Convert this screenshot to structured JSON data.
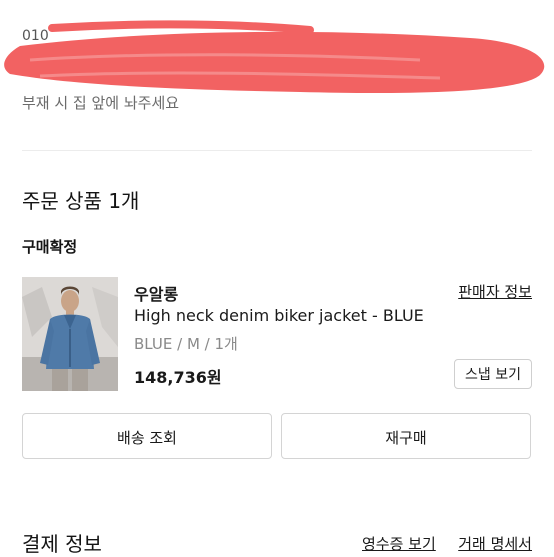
{
  "delivery": {
    "note": "부재 시 집 앞에 놔주세요",
    "redaction_color": "#f26262"
  },
  "order": {
    "title": "주문 상품 1개",
    "status": "구매확정",
    "item": {
      "brand": "우알롱",
      "seller_info_label": "판매자 정보",
      "name": "High neck denim biker jacket - BLUE",
      "options": "BLUE / M / 1개",
      "price": "148,736원",
      "snap_label": "스냅 보기",
      "thumbnail_icon": "product-photo"
    },
    "actions": {
      "track_label": "배송 조회",
      "reorder_label": "재구매"
    }
  },
  "payment": {
    "title": "결제 정보",
    "receipt_label": "영수증 보기",
    "statement_label": "거래 명세서"
  }
}
